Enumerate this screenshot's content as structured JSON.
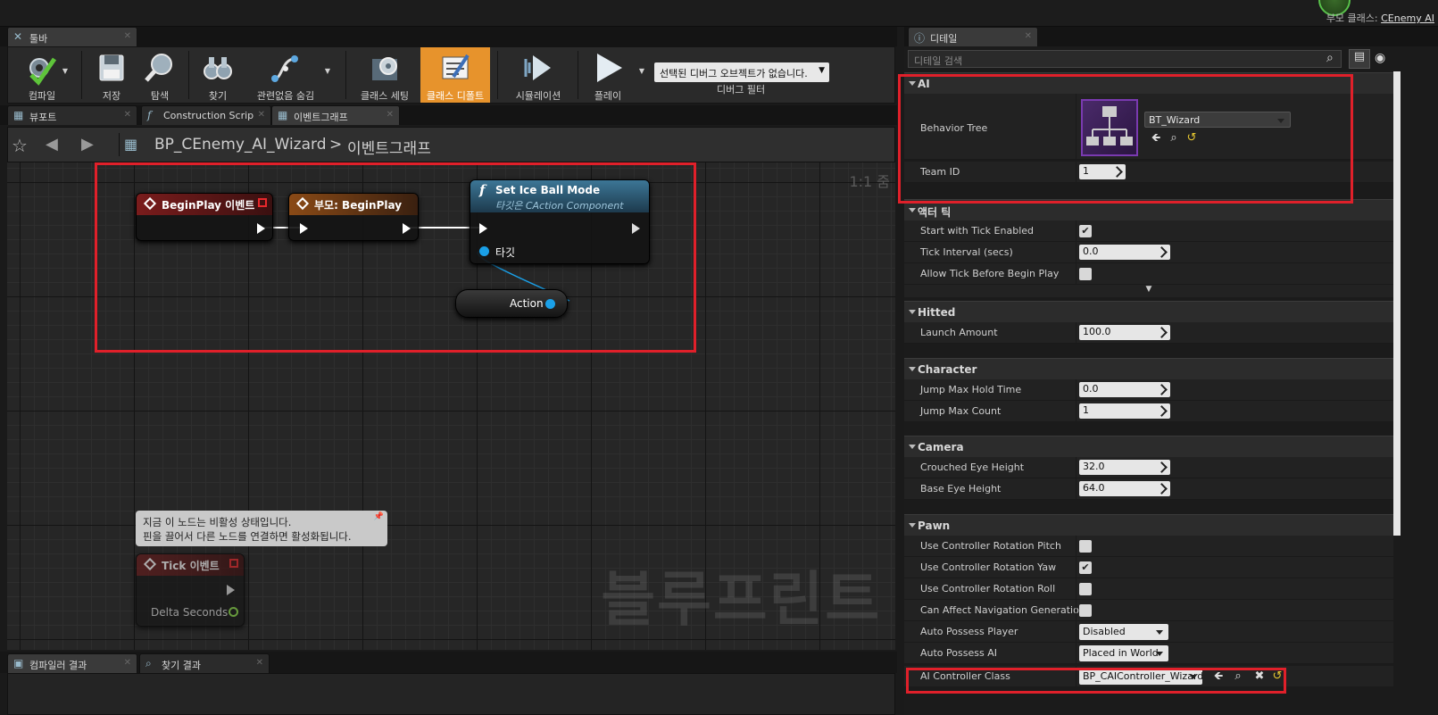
{
  "topbar": {
    "parent_label": "부모 클래스:",
    "parent_value": "CEnemy AI"
  },
  "toolbar_tab": {
    "label": "툴바"
  },
  "toolbar": {
    "compile": "컴파일",
    "save": "저장",
    "browse": "탐색",
    "find": "찾기",
    "hide_unrelated": "관련없음 숨김",
    "class_settings": "클래스 세팅",
    "class_defaults": "클래스 디폴트",
    "simulation": "시뮬레이션",
    "play": "플레이",
    "debug_select": "선택된 디버그 오브젝트가 없습니다.",
    "debug_filter": "디버그 필터"
  },
  "editor_tabs": [
    "뷰포트",
    "Construction Scrip",
    "이벤트그래프"
  ],
  "breadcrumb": {
    "blueprint": "BP_CEnemy_AI_Wizard",
    "separator": ">",
    "graph": "이벤트그래프",
    "zoom": "1:1 줌"
  },
  "nodes": {
    "begin_play": "BeginPlay 이벤트",
    "parent_begin_play": "부모: BeginPlay",
    "set_ice_ball": "Set Ice Ball Mode",
    "set_ice_ball_sub": "타깃은 CAction Component",
    "target_pin": "타깃",
    "action": "Action",
    "tick": "Tick 이벤트",
    "delta_seconds": "Delta Seconds",
    "tooltip_line1": "지금 이 노드는 비활성 상태입니다.",
    "tooltip_line2": "핀을 끌어서 다른 노드를 연결하면 활성화됩니다."
  },
  "watermark": "블루프린트",
  "bottom_tabs": [
    "컴파일러 결과",
    "찾기 결과"
  ],
  "details": {
    "tab": "디테일",
    "search_placeholder": "디테일 검색",
    "sections": {
      "ai": "AI",
      "actor_tick": "액터 틱",
      "hitted": "Hitted",
      "character": "Character",
      "camera": "Camera",
      "pawn": "Pawn"
    },
    "ai": {
      "behavior_tree_label": "Behavior Tree",
      "behavior_tree_value": "BT_Wizard",
      "team_id_label": "Team ID",
      "team_id_value": "1"
    },
    "actor_tick": {
      "start_label": "Start with Tick Enabled",
      "start_checked": true,
      "interval_label": "Tick Interval (secs)",
      "interval_value": "0.0",
      "allow_label": "Allow Tick Before Begin Play",
      "allow_checked": false
    },
    "hitted": {
      "launch_label": "Launch Amount",
      "launch_value": "100.0"
    },
    "character": {
      "hold_label": "Jump Max Hold Time",
      "hold_value": "0.0",
      "count_label": "Jump Max Count",
      "count_value": "1"
    },
    "camera": {
      "crouch_label": "Crouched Eye Height",
      "crouch_value": "32.0",
      "base_label": "Base Eye Height",
      "base_value": "64.0"
    },
    "pawn": {
      "pitch_label": "Use Controller Rotation Pitch",
      "pitch_checked": false,
      "yaw_label": "Use Controller Rotation Yaw",
      "yaw_checked": true,
      "roll_label": "Use Controller Rotation Roll",
      "roll_checked": false,
      "nav_label": "Can Affect Navigation Generation",
      "nav_checked": false,
      "possess_player_label": "Auto Possess Player",
      "possess_player_value": "Disabled",
      "possess_ai_label": "Auto Possess AI",
      "possess_ai_value": "Placed in World",
      "ai_controller_label": "AI Controller Class",
      "ai_controller_value": "BP_CAIController_Wizard"
    }
  },
  "colors": {
    "highlight": "#e0202a",
    "active_button": "#e7932c",
    "exec_pin": "#ffffff",
    "data_pin": "#1aa0e8"
  }
}
